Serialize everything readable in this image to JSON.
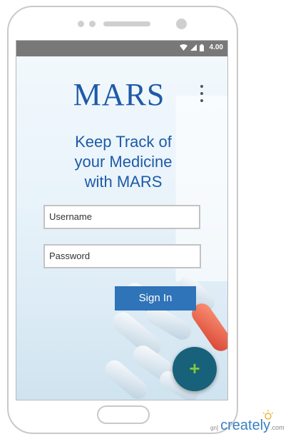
{
  "app": {
    "logo": "MARS",
    "tagline": "Keep Track of\nyour Medicine\nwith MARS"
  },
  "status_bar": {
    "time": "4.00",
    "icons": [
      "wifi-icon",
      "signal-icon",
      "battery-icon"
    ]
  },
  "form": {
    "username_placeholder": "Username",
    "password_placeholder": "Password",
    "signin_label": "Sign In"
  },
  "fab": {
    "label": "+"
  },
  "colors": {
    "brand_blue": "#1e5aa8",
    "button_blue": "#2f73b8",
    "fab_bg": "#17617a",
    "fab_plus": "#7ec93a",
    "status_bar": "#787878"
  },
  "watermark": {
    "prefix": "gn]",
    "brand": "creately",
    "suffix": ".com"
  }
}
